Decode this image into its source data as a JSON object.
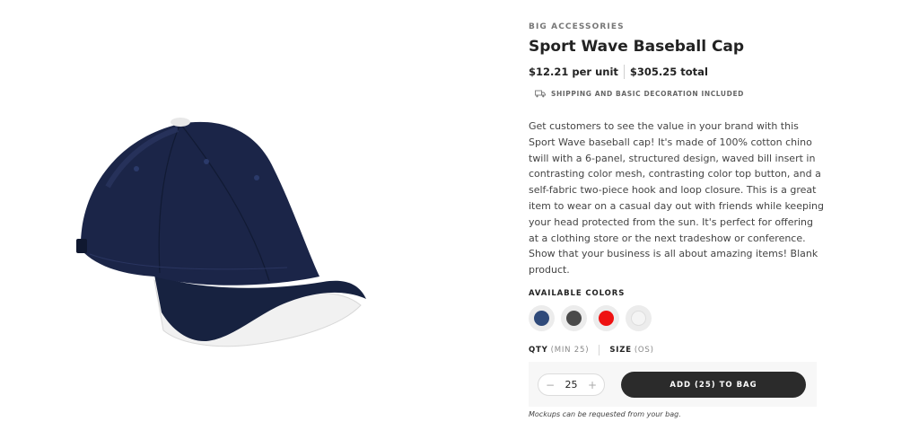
{
  "product": {
    "brand": "BIG ACCESSORIES",
    "title": "Sport Wave Baseball Cap",
    "unit_price": "$12.21 per unit",
    "total_price": "$305.25 total",
    "shipping_note": "SHIPPING AND BASIC DECORATION INCLUDED",
    "description": "Get customers to see the value in your brand with this Sport Wave baseball cap! It's made of 100% cotton chino twill with a 6-panel, structured design, waved bill insert in contrasting color mesh, contrasting color top button, and a self-fabric two-piece hook and loop closure. This is a great item to wear on a casual day out with friends while keeping your head protected from the sun. It's perfect for offering at a clothing store or the next tradeshow or conference. Show that your business is all about amazing items! Blank product.",
    "image_icon": "navy-white-baseball-cap"
  },
  "colors": {
    "label": "AVAILABLE COLORS",
    "swatches": [
      "#2f4a7a",
      "#4a4a4a",
      "#ee1111",
      "#f4f4f4"
    ]
  },
  "options": {
    "qty_label": "QTY",
    "qty_hint": "(MIN 25)",
    "size_label": "SIZE",
    "size_hint": "(OS)"
  },
  "purchase": {
    "quantity": "25",
    "decrement_symbol": "−",
    "increment_symbol": "+",
    "add_button": "ADD (25) TO BAG",
    "note": "Mockups can be requested from your bag."
  }
}
